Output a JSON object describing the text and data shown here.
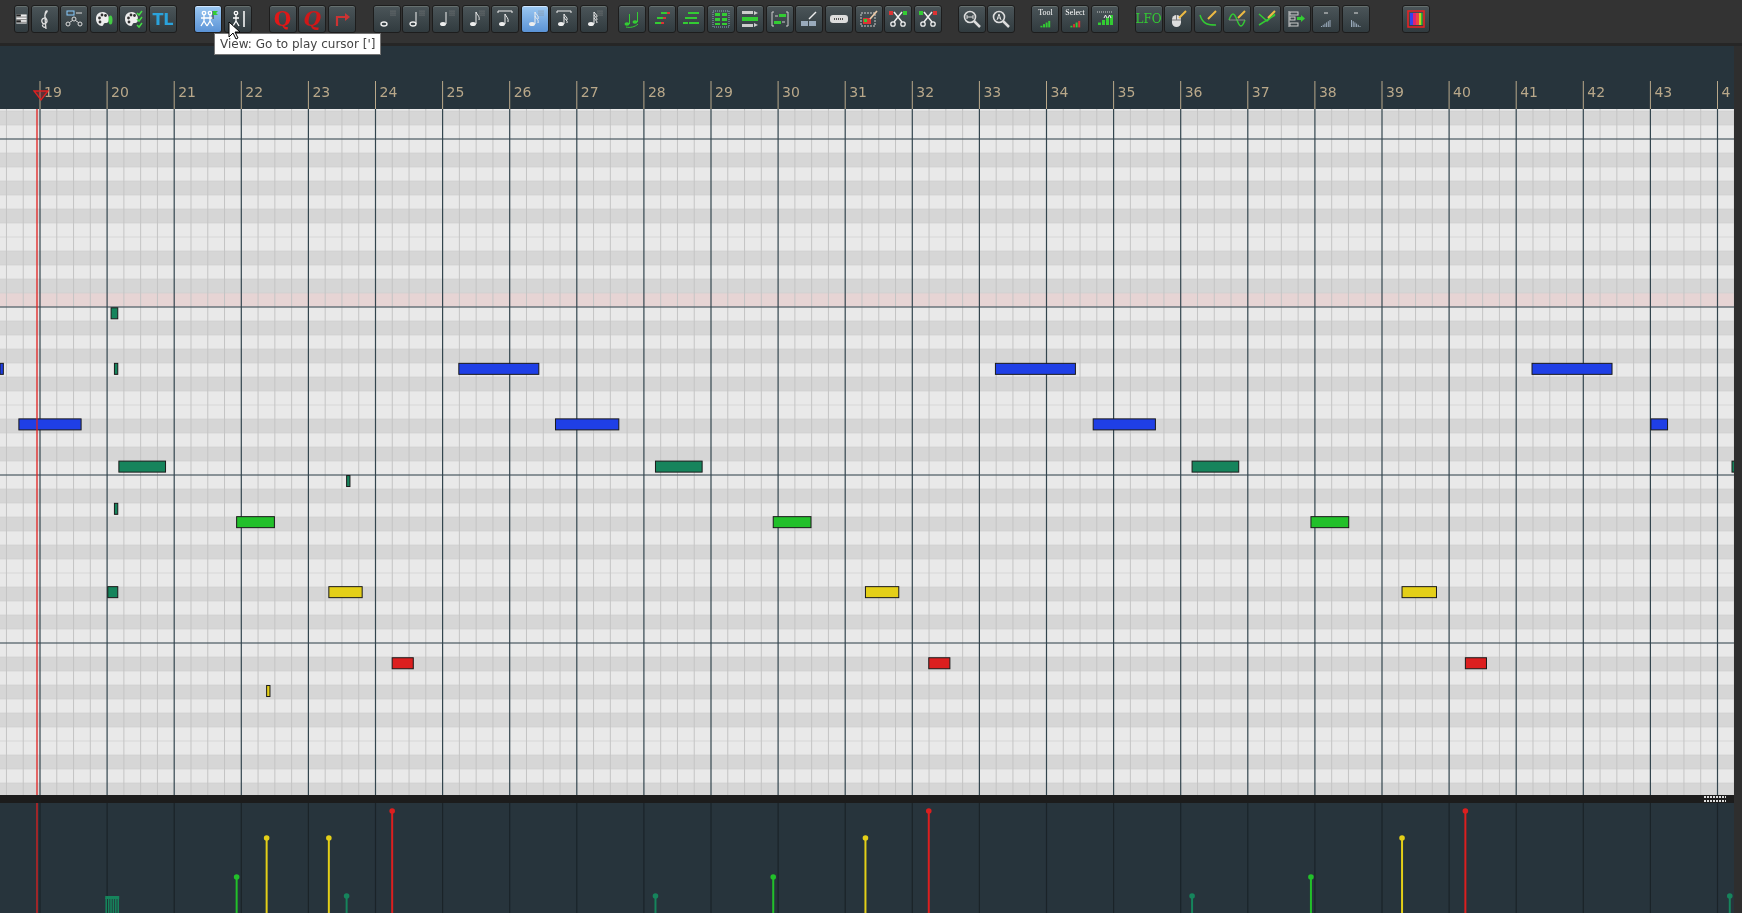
{
  "toolbar": {
    "groups": [
      {
        "buttons": [
          {
            "kind": "keys",
            "selected": false
          },
          {
            "kind": "clef",
            "selected": false
          },
          {
            "kind": "nodes",
            "selected": false
          },
          {
            "kind": "palette",
            "selected": false
          },
          {
            "kind": "palette-check",
            "selected": false
          },
          {
            "kind": "text",
            "label": "TL",
            "selected": false
          }
        ]
      },
      {
        "buttons": [
          {
            "kind": "walkers",
            "selected": true
          },
          {
            "kind": "runner",
            "selected": false
          }
        ]
      },
      {
        "buttons": [
          {
            "kind": "text-red",
            "label": "Q",
            "selected": false
          },
          {
            "kind": "text-red-italic",
            "label": "Q",
            "selected": false
          },
          {
            "kind": "redo",
            "selected": false
          }
        ]
      },
      {
        "buttons": [
          {
            "kind": "note-whole",
            "selected": false
          },
          {
            "kind": "note-half",
            "selected": false
          },
          {
            "kind": "note-quarter",
            "selected": false
          },
          {
            "kind": "note-eighth",
            "selected": false
          },
          {
            "kind": "note-triplet",
            "selected": false
          },
          {
            "kind": "note-sixteenth",
            "selected": true
          },
          {
            "kind": "note-triplet-sixteenth",
            "selected": false
          },
          {
            "kind": "note-thirtysecond",
            "selected": false
          }
        ]
      },
      {
        "buttons": [
          {
            "kind": "two-notes",
            "selected": false
          },
          {
            "kind": "bars-red",
            "selected": false
          },
          {
            "kind": "bars-green",
            "selected": false
          },
          {
            "kind": "grid",
            "selected": false
          },
          {
            "kind": "lanes",
            "selected": false
          },
          {
            "kind": "brackets",
            "selected": false
          },
          {
            "kind": "pen-bars",
            "selected": false
          },
          {
            "kind": "razor",
            "selected": false
          },
          {
            "kind": "select-pen",
            "selected": false
          },
          {
            "kind": "scissors-red",
            "selected": false
          },
          {
            "kind": "scissors-green",
            "selected": false
          }
        ]
      },
      {
        "buttons": [
          {
            "kind": "zoom-h",
            "selected": false
          },
          {
            "kind": "zoom-a",
            "selected": false
          }
        ]
      },
      {
        "buttons": [
          {
            "kind": "meter-text",
            "label": "Tool",
            "selected": false
          },
          {
            "kind": "meter-text-red",
            "label": "Select",
            "selected": false
          },
          {
            "kind": "meter-arrows",
            "selected": false
          }
        ]
      },
      {
        "buttons": [
          {
            "kind": "text-green",
            "label": "LFO",
            "selected": false
          },
          {
            "kind": "mouse-pen",
            "selected": false
          },
          {
            "kind": "curve-pen",
            "selected": false
          },
          {
            "kind": "sine-pen",
            "selected": false
          },
          {
            "kind": "line-pen",
            "selected": false
          },
          {
            "kind": "step-arrow",
            "selected": false
          },
          {
            "kind": "ramp-up",
            "selected": false
          },
          {
            "kind": "ramp-down",
            "selected": false
          }
        ]
      },
      {
        "buttons": [
          {
            "kind": "spectrum",
            "selected": false
          }
        ]
      }
    ]
  },
  "tooltip": {
    "text": "View: Go to play cursor [']"
  },
  "ruler": {
    "measures": [
      "19",
      "20",
      "21",
      "22",
      "23",
      "24",
      "25",
      "26",
      "27",
      "28",
      "29",
      "30",
      "31",
      "32",
      "33",
      "34",
      "35",
      "36",
      "37",
      "38",
      "39",
      "40",
      "41",
      "42",
      "43",
      "4"
    ]
  },
  "notes": [
    {
      "color": "#1f3fe6"
    },
    {
      "color": "#1f3fe6"
    },
    {
      "color": "#16845c"
    },
    {
      "color": "#16845c"
    },
    {
      "color": "#16845c"
    },
    {
      "color": "#16845c"
    },
    {
      "color": "#16845c"
    },
    {
      "color": "#22c02a"
    },
    {
      "color": "#e4cf18"
    },
    {
      "color": "#e4cf18"
    },
    {
      "color": "#16845c"
    },
    {
      "color": "#dc1f1f"
    },
    {
      "color": "#1f3fe6"
    },
    {
      "color": "#1f3fe6"
    },
    {
      "color": "#16845c"
    },
    {
      "color": "#22c02a"
    },
    {
      "color": "#e4cf18"
    },
    {
      "color": "#dc1f1f"
    },
    {
      "color": "#1f3fe6"
    },
    {
      "color": "#1f3fe6"
    },
    {
      "color": "#16845c"
    },
    {
      "color": "#22c02a"
    },
    {
      "color": "#e4cf18"
    },
    {
      "color": "#dc1f1f"
    },
    {
      "color": "#1f3fe6"
    },
    {
      "color": "#1f3fe6"
    },
    {
      "color": "#16845c"
    }
  ]
}
